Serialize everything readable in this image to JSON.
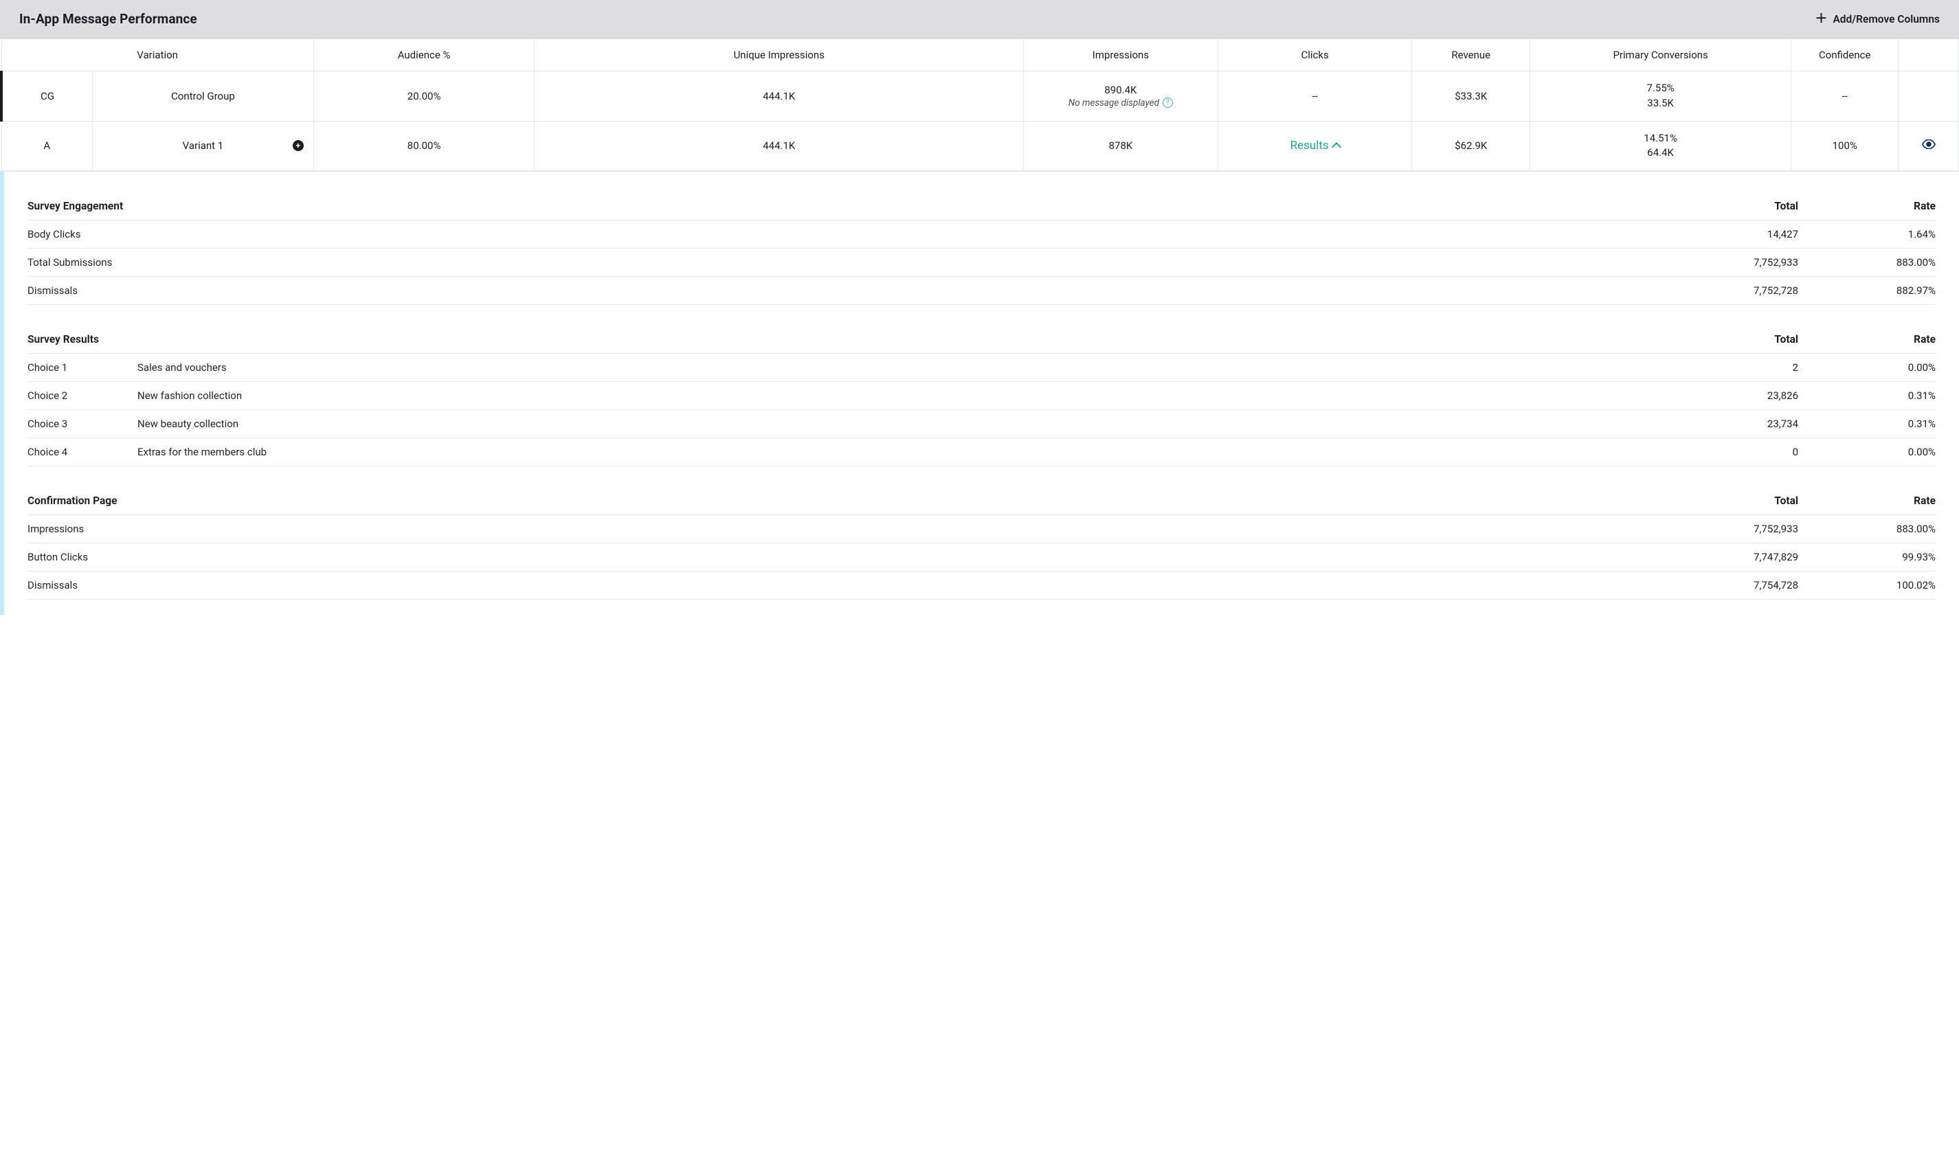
{
  "header": {
    "title": "In-App Message Performance",
    "add_remove_label": "Add/Remove Columns"
  },
  "table": {
    "columns": {
      "variation": "Variation",
      "audience": "Audience %",
      "unique_impressions": "Unique Impressions",
      "impressions": "Impressions",
      "clicks": "Clicks",
      "revenue": "Revenue",
      "primary_conversions": "Primary Conversions",
      "confidence": "Confidence"
    },
    "rows": [
      {
        "badge": "CG",
        "name": "Control Group",
        "audience": "20.00%",
        "unique_impressions": "444.1K",
        "impressions": "890.4K",
        "impressions_note": "No message displayed",
        "clicks": "--",
        "revenue": "$33.3K",
        "conv_pct": "7.55%",
        "conv_count": "33.5K",
        "confidence": "--",
        "is_control": true
      },
      {
        "badge": "A",
        "name": "Variant 1",
        "audience": "80.00%",
        "unique_impressions": "444.1K",
        "impressions": "878K",
        "clicks_link": "Results",
        "revenue": "$62.9K",
        "conv_pct": "14.51%",
        "conv_count": "64.4K",
        "confidence": "100%",
        "is_control": false,
        "expandable": true
      }
    ]
  },
  "details": {
    "sections": [
      {
        "title": "Survey Engagement",
        "col_total": "Total",
        "col_rate": "Rate",
        "rows": [
          {
            "label": "Body Clicks",
            "total": "14,427",
            "rate": "1.64%"
          },
          {
            "label": "Total Submissions",
            "total": "7,752,933",
            "rate": "883.00%"
          },
          {
            "label": "Dismissals",
            "total": "7,752,728",
            "rate": "882.97%"
          }
        ]
      },
      {
        "title": "Survey Results",
        "col_total": "Total",
        "col_rate": "Rate",
        "rows": [
          {
            "label": "Choice 1",
            "desc": "Sales and vouchers",
            "total": "2",
            "rate": "0.00%"
          },
          {
            "label": "Choice 2",
            "desc": "New fashion collection",
            "total": "23,826",
            "rate": "0.31%"
          },
          {
            "label": "Choice 3",
            "desc": "New beauty collection",
            "total": "23,734",
            "rate": "0.31%"
          },
          {
            "label": "Choice 4",
            "desc": "Extras for the members club",
            "total": "0",
            "rate": "0.00%"
          }
        ]
      },
      {
        "title": "Confirmation Page",
        "col_total": "Total",
        "col_rate": "Rate",
        "rows": [
          {
            "label": "Impressions",
            "total": "7,752,933",
            "rate": "883.00%"
          },
          {
            "label": "Button Clicks",
            "total": "7,747,829",
            "rate": "99.93%"
          },
          {
            "label": "Dismissals",
            "total": "7,754,728",
            "rate": "100.02%"
          }
        ]
      }
    ]
  }
}
